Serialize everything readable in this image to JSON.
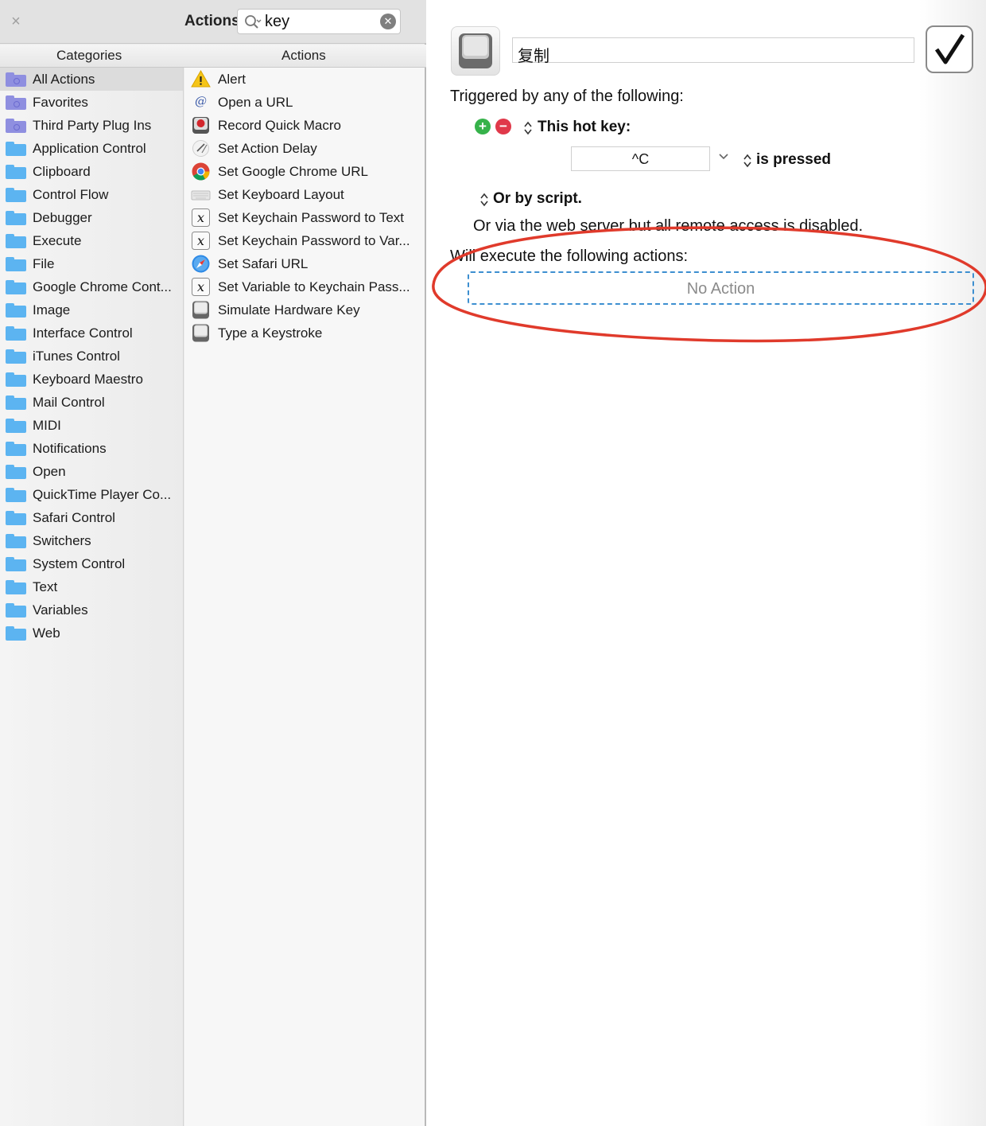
{
  "palette": {
    "title": "Actions",
    "search": {
      "value": "key"
    },
    "headers": {
      "categories": "Categories",
      "actions": "Actions"
    },
    "categories": [
      {
        "label": "All Actions",
        "icon": "smart-folder-icon",
        "selected": true
      },
      {
        "label": "Favorites",
        "icon": "smart-folder-icon"
      },
      {
        "label": "Third Party Plug Ins",
        "icon": "smart-folder-icon"
      },
      {
        "label": "Application Control",
        "icon": "folder-icon"
      },
      {
        "label": "Clipboard",
        "icon": "folder-icon"
      },
      {
        "label": "Control Flow",
        "icon": "folder-icon"
      },
      {
        "label": "Debugger",
        "icon": "folder-icon"
      },
      {
        "label": "Execute",
        "icon": "folder-icon"
      },
      {
        "label": "File",
        "icon": "folder-icon"
      },
      {
        "label": "Google Chrome Cont...",
        "icon": "folder-icon"
      },
      {
        "label": "Image",
        "icon": "folder-icon"
      },
      {
        "label": "Interface Control",
        "icon": "folder-icon"
      },
      {
        "label": "iTunes Control",
        "icon": "folder-icon"
      },
      {
        "label": "Keyboard Maestro",
        "icon": "folder-icon"
      },
      {
        "label": "Mail Control",
        "icon": "folder-icon"
      },
      {
        "label": "MIDI",
        "icon": "folder-icon"
      },
      {
        "label": "Notifications",
        "icon": "folder-icon"
      },
      {
        "label": "Open",
        "icon": "folder-icon"
      },
      {
        "label": "QuickTime Player Co...",
        "icon": "folder-icon"
      },
      {
        "label": "Safari Control",
        "icon": "folder-icon"
      },
      {
        "label": "Switchers",
        "icon": "folder-icon"
      },
      {
        "label": "System Control",
        "icon": "folder-icon"
      },
      {
        "label": "Text",
        "icon": "folder-icon"
      },
      {
        "label": "Variables",
        "icon": "folder-icon"
      },
      {
        "label": "Web",
        "icon": "folder-icon"
      }
    ],
    "actions": [
      {
        "label": "Alert",
        "icon": "warning-icon"
      },
      {
        "label": "Open a URL",
        "icon": "at-sign-icon"
      },
      {
        "label": "Record Quick Macro",
        "icon": "record-icon"
      },
      {
        "label": "Set Action Delay",
        "icon": "delay-icon"
      },
      {
        "label": "Set Google Chrome URL",
        "icon": "chrome-icon"
      },
      {
        "label": "Set Keyboard Layout",
        "icon": "keyboard-icon"
      },
      {
        "label": "Set Keychain Password to Text",
        "icon": "variable-icon"
      },
      {
        "label": "Set Keychain Password to Var...",
        "icon": "variable-icon"
      },
      {
        "label": "Set Safari URL",
        "icon": "safari-icon"
      },
      {
        "label": "Set Variable to Keychain Pass...",
        "icon": "variable-icon"
      },
      {
        "label": "Simulate Hardware Key",
        "icon": "keycap-icon"
      },
      {
        "label": "Type a Keystroke",
        "icon": "keycap-icon"
      }
    ]
  },
  "editor": {
    "macro_name": "复制",
    "triggered_heading": "Triggered by any of the following:",
    "hotkey_label": "This hot key:",
    "hotkey_value": "^C",
    "pressed_label": "is pressed",
    "script_label": "Or by script.",
    "webserver_text": "Or via the web server but all remote access is disabled.",
    "execute_heading": "Will execute the following actions:",
    "no_action": "No Action"
  },
  "colors": {
    "highlight_ellipse": "#e03a2b",
    "dropzone_border": "#3d8fd0",
    "folder": "#5cb4f1",
    "smart_folder": "#8f8fe0"
  }
}
